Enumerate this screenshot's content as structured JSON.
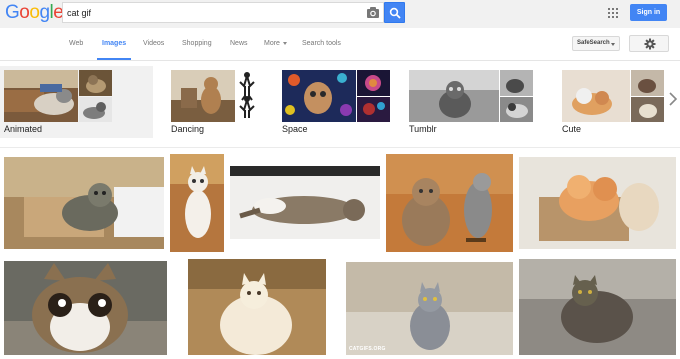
{
  "logo": {
    "letters": [
      "G",
      "o",
      "o",
      "g",
      "l",
      "e"
    ],
    "colors": [
      "#4285f4",
      "#ea4335",
      "#fbbc05",
      "#4285f4",
      "#34a853",
      "#ea4335"
    ]
  },
  "search": {
    "query": "cat gif",
    "camera_icon": "camera-icon",
    "button_icon": "search-icon"
  },
  "header": {
    "apps_icon": "apps-grid-icon",
    "signin_label": "Sign in"
  },
  "nav": {
    "tabs": [
      {
        "label": "Web",
        "active": false
      },
      {
        "label": "Images",
        "active": true
      },
      {
        "label": "Videos",
        "active": false
      },
      {
        "label": "Shopping",
        "active": false
      },
      {
        "label": "News",
        "active": false
      },
      {
        "label": "More",
        "active": false,
        "dropdown": true
      },
      {
        "label": "Search tools",
        "active": false
      }
    ],
    "safesearch_label": "SafeSearch",
    "settings_icon": "gear-icon"
  },
  "related": [
    {
      "label": "Animated",
      "selected": true
    },
    {
      "label": "Dancing"
    },
    {
      "label": "Space"
    },
    {
      "label": "Tumblr"
    },
    {
      "label": "Cute"
    }
  ],
  "results": {
    "watermark_text": "CATGIFS.ORG"
  },
  "colors": {
    "accent": "#4285f4",
    "header_bg": "#f1f1f1",
    "active_tab": "#4285f4"
  }
}
